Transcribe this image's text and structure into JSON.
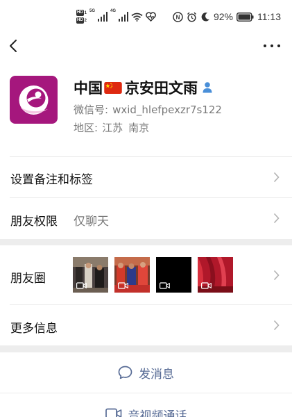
{
  "status_bar": {
    "hd1": "HD",
    "hd1_num": "1",
    "hd2": "HD",
    "hd2_num": "2",
    "net1": "5G",
    "net2": "4G",
    "battery": "92%",
    "time": "11:13",
    "icons": [
      "signal-icon",
      "wifi-icon",
      "heart-icon",
      "alarm-icon",
      "moon-icon",
      "nfc-icon",
      "battery-icon"
    ]
  },
  "nav": {
    "icons": [
      "back-icon",
      "more-icon"
    ]
  },
  "profile": {
    "name_prefix": "中国",
    "name_suffix": "京安田文雨",
    "wechat_id_label": "微信号:",
    "wechat_id": "wxid_hlefpexzr7s122",
    "region_label": "地区:",
    "region_province": "江苏",
    "region_city": "南京",
    "avatar_color": "#a5177d",
    "verify_color": "#4a8fd8"
  },
  "rows": {
    "remark_tags": "设置备注和标签",
    "friend_perm_label": "朋友权限",
    "friend_perm_value": "仅聊天",
    "moments": "朋友圈",
    "more_info": "更多信息"
  },
  "actions": {
    "send_message": "发消息",
    "av_call": "音视频通话",
    "link_color": "#576b95"
  }
}
